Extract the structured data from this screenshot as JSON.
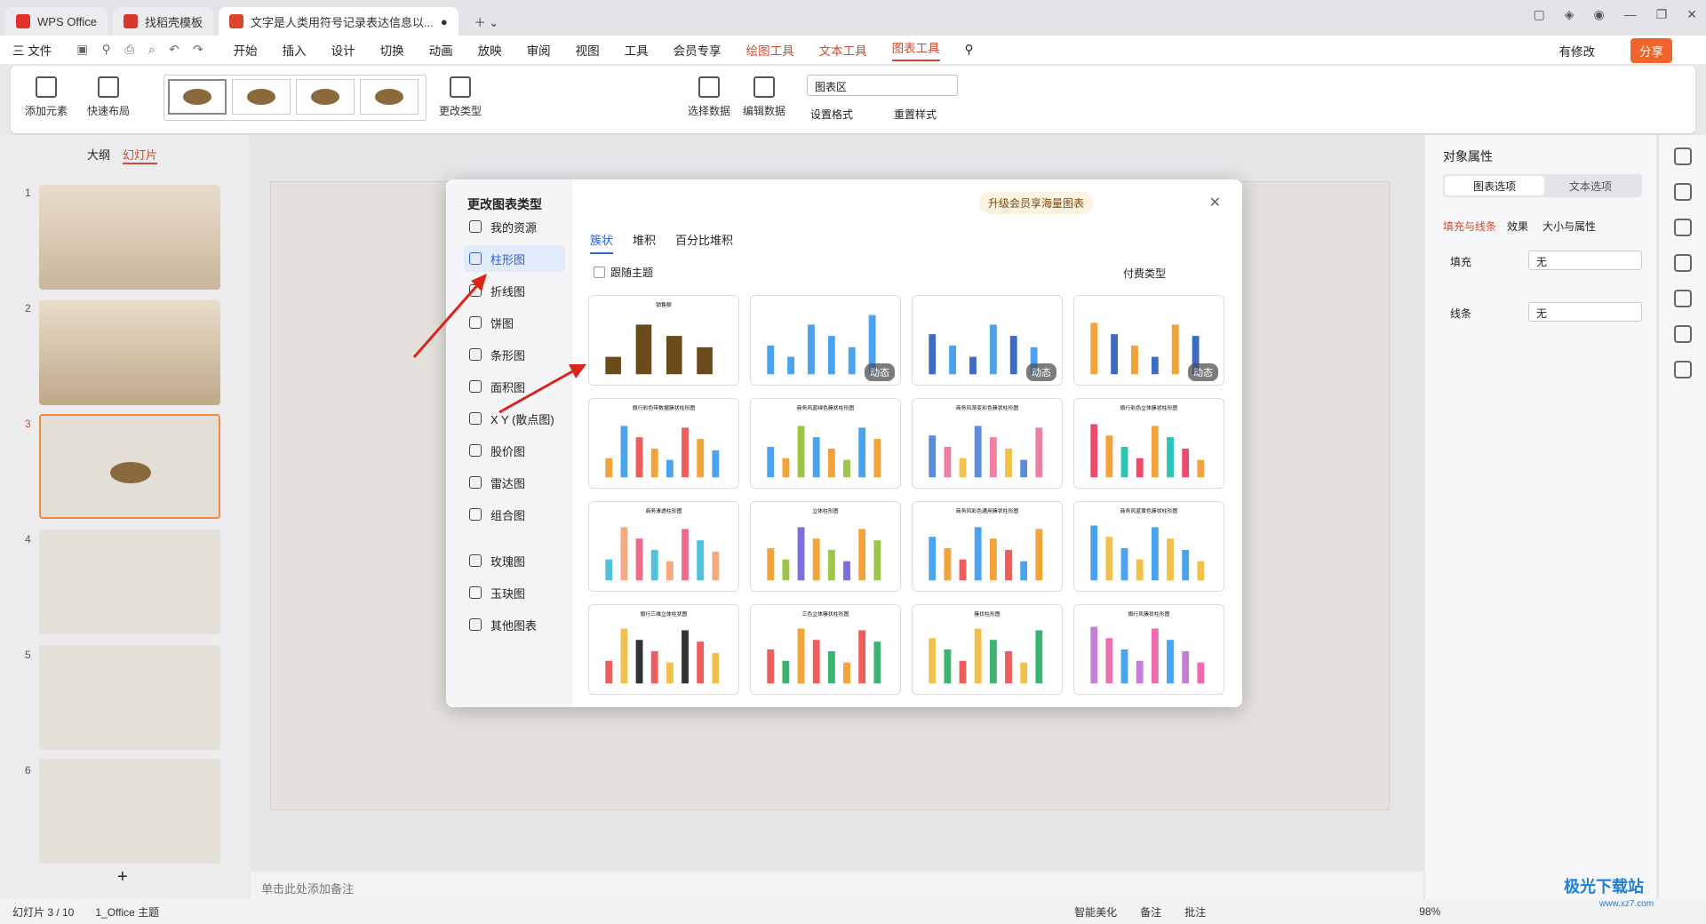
{
  "tabs": [
    "WPS Office",
    "找稻壳模板",
    "文字是人类用符号记录表达信息以..."
  ],
  "menu": [
    "三 文件",
    "开始",
    "插入",
    "设计",
    "切换",
    "动画",
    "放映",
    "审阅",
    "视图",
    "工具",
    "会员专享",
    "绘图工具",
    "文本工具",
    "图表工具"
  ],
  "menu_right": {
    "modify": "有修改",
    "share": "分享"
  },
  "ribbon": {
    "add_element": "添加元素",
    "quick_layout": "快速布局",
    "change_type": "更改类型",
    "select_data": "选择数据",
    "edit_data": "编辑数据",
    "area_combo": "图表区",
    "set_format": "设置格式",
    "reset_style": "重置样式"
  },
  "left_tabs": [
    "大纲",
    "幻灯片"
  ],
  "slide_numbers": [
    "1",
    "2",
    "3",
    "4",
    "5",
    "6"
  ],
  "notes_placeholder": "单击此处添加备注",
  "right_panel": {
    "title": "对象属性",
    "tab1": "图表选项",
    "tab2": "文本选项",
    "sub": [
      "填充与线条",
      "效果",
      "大小与属性"
    ],
    "fill_label": "填充",
    "fill_value": "无",
    "line_label": "线条",
    "line_value": "无"
  },
  "status": {
    "slide": "幻灯片 3 / 10",
    "theme": "1_Office 主题",
    "beautify": "智能美化",
    "notes": "备注",
    "comment": "批注",
    "zoom": "98%"
  },
  "dialog": {
    "title": "更改图表类型",
    "upgrade": "升级会员享海量图表",
    "categories": [
      "我的资源",
      "柱形图",
      "折线图",
      "饼图",
      "条形图",
      "面积图",
      "X Y (散点图)",
      "股价图",
      "雷达图",
      "组合图",
      "玫瑰图",
      "玉玦图",
      "其他图表"
    ],
    "selected_category": "柱形图",
    "subtabs": [
      "簇状",
      "堆积",
      "百分比堆积"
    ],
    "follow_theme": "跟随主题",
    "paid_type": "付费类型",
    "dynamic_badge": "动态",
    "sample_title": "销售额",
    "card_titles": [
      "销售额",
      "",
      "",
      "",
      "旗行彩色带数据簇状柱形图",
      "商务风蓝绿色簇状柱形图",
      "商务风渐变彩色簇状柱形图",
      "旗行彩色立体簇状柱形图",
      "商务清透柱形图",
      "立体柱形图",
      "商务风彩色通用簇状柱形图",
      "商务风蓝黄色簇状柱形图",
      "旗行三维立体柱状图",
      "三色立体簇状柱形图",
      "簇状柱形图",
      "旗行风簇状柱形图"
    ]
  },
  "watermark": "极光下载站",
  "watermark_url": "www.xz7.com"
}
